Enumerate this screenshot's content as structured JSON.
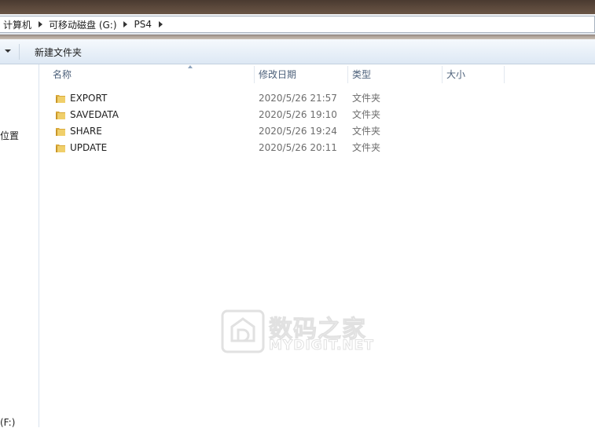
{
  "address_bar": {
    "crumbs": [
      "计算机",
      "可移动磁盘 (G:)",
      "PS4"
    ]
  },
  "toolbar": {
    "new_folder_label": "新建文件夹"
  },
  "nav_pane": {
    "partial_item_top": "位置",
    "partial_item_bottom": "(F:)"
  },
  "columns": {
    "name": "名称",
    "date": "修改日期",
    "type": "类型",
    "size": "大小"
  },
  "files": [
    {
      "name": "EXPORT",
      "date": "2020/5/26 21:57",
      "type": "文件夹",
      "icon": "folder-icon"
    },
    {
      "name": "SAVEDATA",
      "date": "2020/5/26 19:10",
      "type": "文件夹",
      "icon": "folder-icon"
    },
    {
      "name": "SHARE",
      "date": "2020/5/26 19:24",
      "type": "文件夹",
      "icon": "folder-icon"
    },
    {
      "name": "UPDATE",
      "date": "2020/5/26 20:11",
      "type": "文件夹",
      "icon": "folder-icon"
    }
  ],
  "watermark": {
    "cn": "数码之家",
    "en": "MYDIGIT.NET"
  },
  "colors": {
    "folder": "#e8c45a",
    "header_text": "#4c607a",
    "meta_text": "#6d6d6d"
  }
}
